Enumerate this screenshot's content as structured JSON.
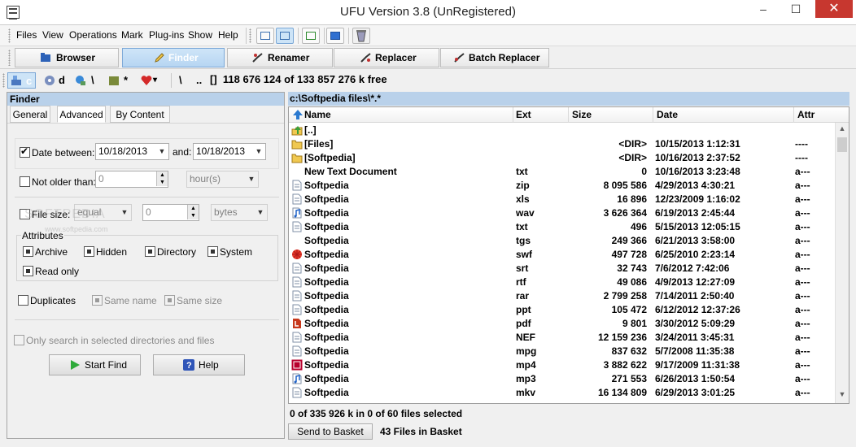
{
  "window": {
    "title": "UFU Version 3.8 (UnRegistered)",
    "minimize": "–",
    "maximize": "☐",
    "close": "✕"
  },
  "menu": [
    "Files",
    "View",
    "Operations",
    "Mark",
    "Plug-ins",
    "Show",
    "Help"
  ],
  "tabs": [
    "Browser",
    "Finder",
    "Renamer",
    "Replacer",
    "Batch Replacer"
  ],
  "active_tab": "Finder",
  "drives": {
    "c": "c",
    "d": "d",
    "net": "\\",
    "pkg": "*",
    "fav": "▾",
    "root": "\\",
    "up": "..",
    "brackets": "[]"
  },
  "free_space": "118 676 124 of 133 857 276 k free",
  "finder": {
    "header": "Finder",
    "tabs": [
      "General",
      "Advanced",
      "By Content"
    ],
    "date_between_label": "Date between:",
    "date_from": "10/18/2013",
    "and_label": "and:",
    "date_to": "10/18/2013",
    "not_older_label": "Not older than:",
    "not_older_value": "0",
    "not_older_unit": "hour(s)",
    "file_size_label": "File size:",
    "size_op": "equal",
    "size_value": "0",
    "size_unit": "bytes",
    "attributes_label": "Attributes",
    "attributes": [
      "Archive",
      "Hidden",
      "Directory",
      "System",
      "Read only"
    ],
    "duplicates_label": "Duplicates",
    "same_name_label": "Same name",
    "same_size_label": "Same size",
    "only_selected_label": "Only search in selected directories and files",
    "start_find": "Start Find",
    "help": "Help",
    "watermark": "SOFTPEDIA",
    "watermark_sub": "www.softpedia.com"
  },
  "path": "c:\\Softpedia files\\*.*",
  "columns": {
    "name": "Name",
    "ext": "Ext",
    "size": "Size",
    "date": "Date",
    "attr": "Attr"
  },
  "files": [
    {
      "icon": "up-folder",
      "name": "[..]",
      "ext": "",
      "size": "",
      "date": "",
      "attr": ""
    },
    {
      "icon": "folder",
      "name": "[Files]",
      "ext": "",
      "size": "<DIR>",
      "date": "10/15/2013 1:12:31",
      "attr": "----"
    },
    {
      "icon": "folder",
      "name": "[Softpedia]",
      "ext": "",
      "size": "<DIR>",
      "date": "10/16/2013 2:37:52",
      "attr": "----"
    },
    {
      "icon": "none",
      "name": "New Text Document",
      "ext": "txt",
      "size": "0",
      "date": "10/16/2013 3:23:48",
      "attr": "a---"
    },
    {
      "icon": "doc",
      "name": "Softpedia",
      "ext": "zip",
      "size": "8 095 586",
      "date": "4/29/2013 4:30:21",
      "attr": "a---"
    },
    {
      "icon": "doc",
      "name": "Softpedia",
      "ext": "xls",
      "size": "16 896",
      "date": "12/23/2009 1:16:02",
      "attr": "a---"
    },
    {
      "icon": "audio",
      "name": "Softpedia",
      "ext": "wav",
      "size": "3 626 364",
      "date": "6/19/2013 2:45:44",
      "attr": "a---"
    },
    {
      "icon": "doc",
      "name": "Softpedia",
      "ext": "txt",
      "size": "496",
      "date": "5/15/2013 12:05:15",
      "attr": "a---"
    },
    {
      "icon": "none",
      "name": "Softpedia",
      "ext": "tgs",
      "size": "249 366",
      "date": "6/21/2013 3:58:00",
      "attr": "a---"
    },
    {
      "icon": "flash",
      "name": "Softpedia",
      "ext": "swf",
      "size": "497 728",
      "date": "6/25/2010 2:23:14",
      "attr": "a---"
    },
    {
      "icon": "doc",
      "name": "Softpedia",
      "ext": "srt",
      "size": "32 743",
      "date": "7/6/2012 7:42:06",
      "attr": "a---"
    },
    {
      "icon": "doc",
      "name": "Softpedia",
      "ext": "rtf",
      "size": "49 086",
      "date": "4/9/2013 12:27:09",
      "attr": "a---"
    },
    {
      "icon": "doc",
      "name": "Softpedia",
      "ext": "rar",
      "size": "2 799 258",
      "date": "7/14/2011 2:50:40",
      "attr": "a---"
    },
    {
      "icon": "doc",
      "name": "Softpedia",
      "ext": "ppt",
      "size": "105 472",
      "date": "6/12/2012 12:37:26",
      "attr": "a---"
    },
    {
      "icon": "pdf",
      "name": "Softpedia",
      "ext": "pdf",
      "size": "9 801",
      "date": "3/30/2012 5:09:29",
      "attr": "a---"
    },
    {
      "icon": "doc",
      "name": "Softpedia",
      "ext": "NEF",
      "size": "12 159 236",
      "date": "3/24/2011 3:45:31",
      "attr": "a---"
    },
    {
      "icon": "doc",
      "name": "Softpedia",
      "ext": "mpg",
      "size": "837 632",
      "date": "5/7/2008 11:35:38",
      "attr": "a---"
    },
    {
      "icon": "video",
      "name": "Softpedia",
      "ext": "mp4",
      "size": "3 882 622",
      "date": "9/17/2009 11:31:38",
      "attr": "a---"
    },
    {
      "icon": "audio",
      "name": "Softpedia",
      "ext": "mp3",
      "size": "271 553",
      "date": "6/26/2013 1:50:54",
      "attr": "a---"
    },
    {
      "icon": "doc",
      "name": "Softpedia",
      "ext": "mkv",
      "size": "16 134 809",
      "date": "6/29/2013 3:01:25",
      "attr": "a---"
    }
  ],
  "status": "0 of 335 926 k in 0 of 60 files selected",
  "send_to_basket": "Send to Basket",
  "basket_count": "43 Files in Basket"
}
